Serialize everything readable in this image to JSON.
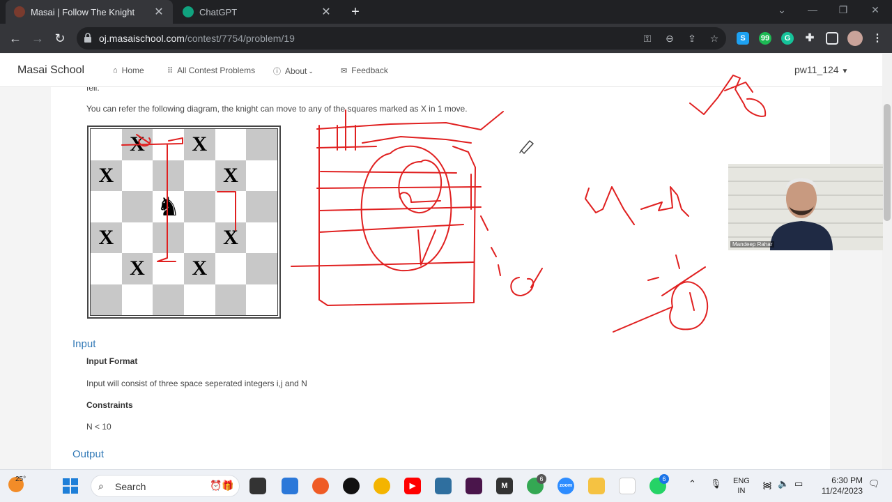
{
  "browser": {
    "tabs": [
      {
        "title": "Masai | Follow The Knight",
        "active": true
      },
      {
        "title": "ChatGPT",
        "active": false
      }
    ],
    "url_host": "oj.masaischool.com",
    "url_path": "/contest/7754/problem/19",
    "extension_labels": [
      "S",
      "99",
      "G"
    ]
  },
  "site": {
    "brand": "Masai School",
    "nav": [
      {
        "label": "Home",
        "icon": "home-icon"
      },
      {
        "label": "All Contest Problems",
        "icon": "grid-icon"
      },
      {
        "label": "About",
        "icon": "info-icon"
      },
      {
        "label": "Feedback",
        "icon": "feedback-icon"
      }
    ],
    "user": "pw11_124"
  },
  "problem": {
    "cut_line": "fell.",
    "diagram_text": "You can refer the following diagram, the knight can move to any of the squares marked as X in 1 move.",
    "board_mark": "X",
    "input_heading": "Input",
    "input_format_label": "Input Format",
    "input_format_text": "Input will consist of three space seperated integers i,j and N",
    "constraints_label": "Constraints",
    "constraints_text": "N < 10",
    "output_heading": "Output"
  },
  "webcam": {
    "name": "Mandeep Rahar"
  },
  "taskbar": {
    "temperature": "25°",
    "search_label": "Search",
    "chrome_badge": "6",
    "zoom_label": "zoom",
    "lang_line1": "ENG",
    "lang_line2": "IN",
    "time": "6:30 PM",
    "date": "11/24/2023"
  },
  "colors": {
    "ink": "#e02020",
    "link": "#337ab7",
    "chrome_dark": "#202124",
    "chrome_mid": "#35363a"
  }
}
